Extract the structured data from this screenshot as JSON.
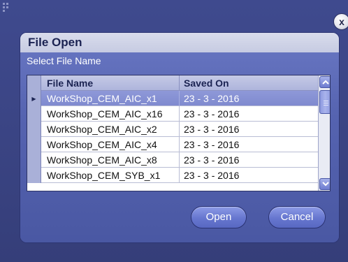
{
  "dialog": {
    "title": "File Open",
    "subtitle": "Select File Name",
    "close_glyph": "x"
  },
  "table": {
    "headers": [
      "File Name",
      "Saved On"
    ],
    "rows": [
      {
        "name": "WorkShop_CEM_AIC_x1",
        "saved": "23 - 3 - 2016",
        "selected": true
      },
      {
        "name": "WorkShop_CEM_AIC_x16",
        "saved": "23 - 3 - 2016",
        "selected": false
      },
      {
        "name": "WorkShop_CEM_AIC_x2",
        "saved": "23 - 3 - 2016",
        "selected": false
      },
      {
        "name": "WorkShop_CEM_AIC_x4",
        "saved": "23 - 3 - 2016",
        "selected": false
      },
      {
        "name": "WorkShop_CEM_AIC_x8",
        "saved": "23 - 3 - 2016",
        "selected": false
      },
      {
        "name": "WorkShop_CEM_SYB_x1",
        "saved": "23 - 3 - 2016",
        "selected": false
      }
    ],
    "selected_marker": "▶"
  },
  "buttons": {
    "open_label": "Open",
    "cancel_label": "Cancel"
  },
  "icons": {
    "scroll_up": "chevron-up-icon",
    "scroll_down": "chevron-down-icon",
    "close": "close-icon",
    "grip": "grip-icon"
  },
  "colors": {
    "panel": "#3b4585",
    "dialog": "#5563b0",
    "selected_row": "#8e98d8"
  }
}
